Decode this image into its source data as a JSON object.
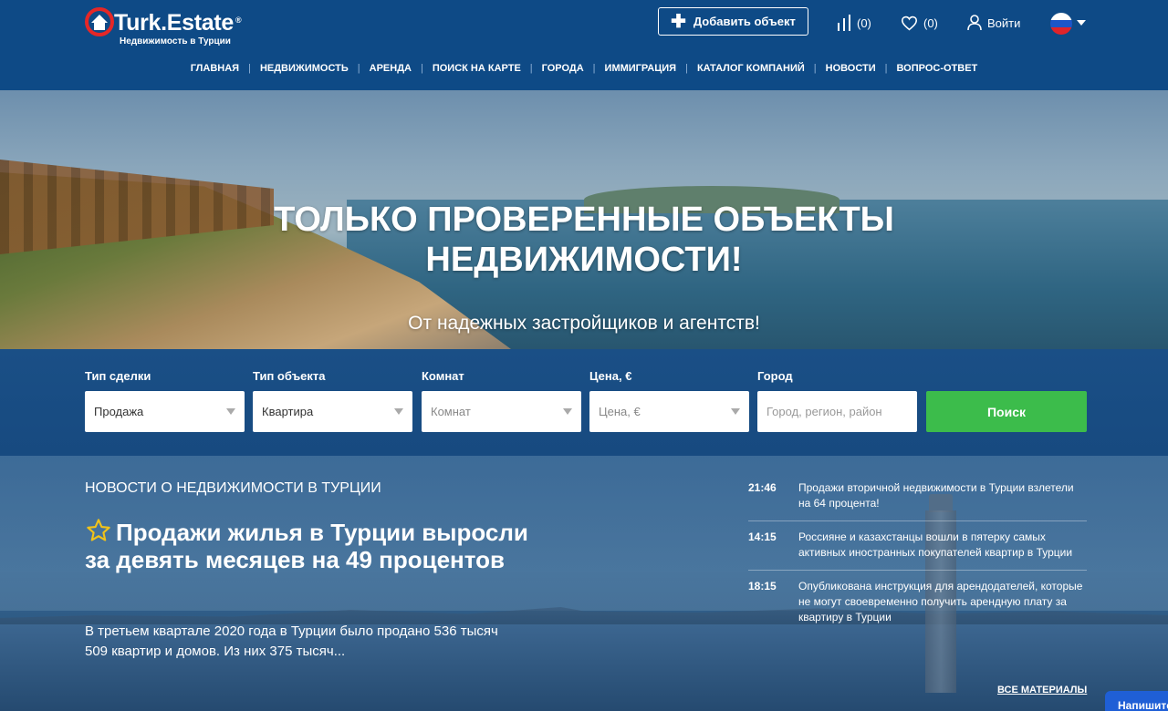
{
  "header": {
    "logo_text": "Turk.Estate",
    "logo_reg": "®",
    "logo_sub": "Недвижимость в Турции",
    "add_button": "Добавить объект",
    "compare_count": "(0)",
    "favorites_count": "(0)",
    "login": "Войти",
    "language_icon": "russia-flag-icon"
  },
  "nav": {
    "items": [
      "ГЛАВНАЯ",
      "НЕДВИЖИМОСТЬ",
      "АРЕНДА",
      "ПОИСК НА КАРТЕ",
      "ГОРОДА",
      "ИММИГРАЦИЯ",
      "КАТАЛОГ КОМПАНИЙ",
      "НОВОСТИ",
      "ВОПРОС-ОТВЕТ"
    ]
  },
  "hero": {
    "title_line1": "ТОЛЬКО ПРОВЕРЕННЫЕ ОБЪЕКТЫ",
    "title_line2": "НЕДВИЖИМОСТИ!",
    "subtitle": "От надежных застройщиков и агентств!"
  },
  "search": {
    "deal_label": "Тип сделки",
    "deal_value": "Продажа",
    "type_label": "Тип объекта",
    "type_value": "Квартира",
    "rooms_label": "Комнат",
    "rooms_value": "Комнат",
    "price_label": "Цена, €",
    "price_value": "Цена, €",
    "city_label": "Город",
    "city_placeholder": "Город, регион, район",
    "button": "Поиск"
  },
  "news": {
    "heading": "НОВОСТИ О НЕДВИЖИМОСТИ В ТУРЦИИ",
    "featured_title": "Продажи жилья в Турции выросли за девять месяцев на 49 процентов",
    "featured_text": "В третьем квартале 2020 года в Турции было продано 536 тысяч 509 квартир и домов. Из них 375 тысяч...",
    "items": [
      {
        "time": "21:46",
        "title": "Продажи вторичной недвижимости в Турции взлетели на 64 процента!"
      },
      {
        "time": "14:15",
        "title": "Россияне и казахстанцы вошли в пятерку самых активных иностранных покупателей квартир в Турции"
      },
      {
        "time": "18:15",
        "title": "Опубликована инструкция для арендодателей, которые не могут своевременно получить арендную плату за квартиру в Турции"
      }
    ],
    "all_link": "ВСЕ МАТЕРИАЛЫ"
  },
  "chat": {
    "label": "Напишите"
  },
  "colors": {
    "header_bg": "#0e4a86",
    "search_button": "#3cbc4b",
    "chat_button": "#1f5fd6"
  }
}
